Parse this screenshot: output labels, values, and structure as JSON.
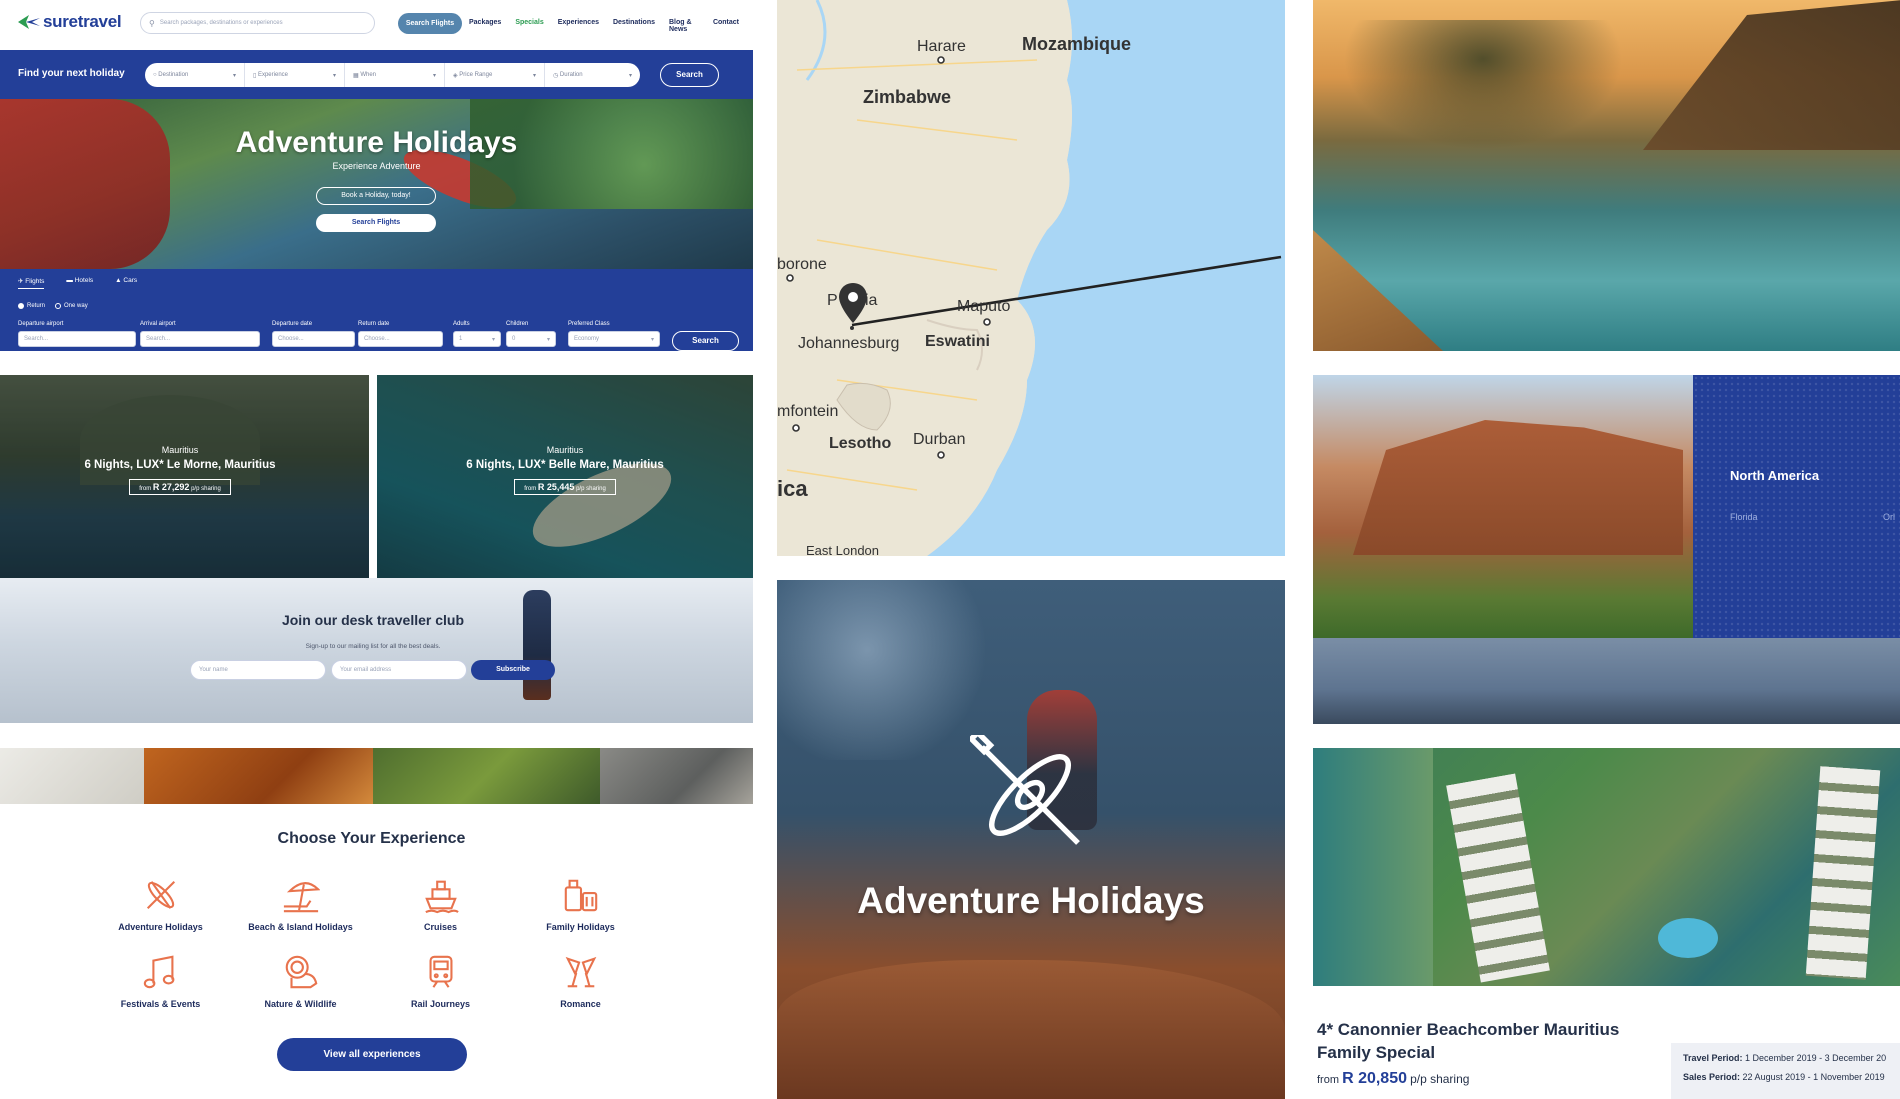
{
  "header": {
    "logo": "suretravel",
    "search_placeholder": "Search packages, destinations or experiences",
    "search_flights": "Search Flights",
    "nav": [
      "Packages",
      "Specials",
      "Experiences",
      "Destinations",
      "Blog & News",
      "Contact"
    ]
  },
  "finder": {
    "title": "Find your next holiday",
    "fields": [
      "Destination",
      "Experience",
      "When",
      "Price Range",
      "Duration"
    ],
    "search": "Search"
  },
  "hero": {
    "title": "Adventure Holidays",
    "subtitle": "Experience Adventure",
    "book_button": "Book a Holiday, today!",
    "search_flights": "Search Flights"
  },
  "flights": {
    "tabs": [
      "Flights",
      "Hotels",
      "Cars"
    ],
    "trip": [
      "Return",
      "One way"
    ],
    "labels": {
      "departure_airport": "Departure airport",
      "arrival_airport": "Arrival airport",
      "departure_date": "Departure date",
      "return_date": "Return date",
      "adults": "Adults",
      "children": "Children",
      "class": "Preferred Class"
    },
    "values": {
      "departure_placeholder": "Search...",
      "arrival_placeholder": "Search...",
      "depdate_placeholder": "Choose...",
      "retdate_placeholder": "Choose...",
      "adults": "1",
      "children": "0",
      "class": "Economy"
    },
    "search": "Search"
  },
  "deals": [
    {
      "location": "Mauritius",
      "title": "6 Nights, LUX* Le Morne, Mauritius",
      "from": "from",
      "price": "R 27,292",
      "sharing": "p/p sharing"
    },
    {
      "location": "Mauritius",
      "title": "6 Nights, LUX* Belle Mare, Mauritius",
      "from": "from",
      "price": "R 25,445",
      "sharing": "p/p sharing"
    }
  ],
  "club": {
    "title": "Join our desk traveller club",
    "subtitle": "Sign-up to our mailing list for all the best deals.",
    "name_placeholder": "Your name",
    "email_placeholder": "Your email address",
    "button": "Subscribe"
  },
  "experience": {
    "title": "Choose Your Experience",
    "items": [
      {
        "label": "Adventure Holidays",
        "icon": "kayak-icon"
      },
      {
        "label": "Beach & Island Holidays",
        "icon": "beach-umbrella-icon"
      },
      {
        "label": "Cruises",
        "icon": "ship-icon"
      },
      {
        "label": "Family Holidays",
        "icon": "luggage-icon"
      },
      {
        "label": "Festivals & Events",
        "icon": "music-note-icon"
      },
      {
        "label": "Nature & Wildlife",
        "icon": "lion-icon"
      },
      {
        "label": "Rail Journeys",
        "icon": "train-icon"
      },
      {
        "label": "Romance",
        "icon": "champagne-glasses-icon"
      }
    ],
    "view_all": "View all experiences"
  },
  "map": {
    "labels": [
      "Harare",
      "Mozambique",
      "Zimbabwe",
      "Gaborone",
      "Pretoria",
      "Maputo",
      "Johannesburg",
      "Eswatini",
      "Bloemfontein",
      "Lesotho",
      "Durban",
      "South Africa",
      "East London"
    ],
    "visible_labels": {
      "harare": "Harare",
      "mozambique": "Mozambique",
      "zimbabwe": "Zimbabwe",
      "gaborone": "borone",
      "pretoria": "P     ria",
      "maputo": "Maputo",
      "johannesburg": "Johannesburg",
      "eswatini": "Eswatini",
      "bloemfontein": "mfontein",
      "lesotho": "Lesotho",
      "durban": "Durban",
      "southafrica": "ica",
      "eastlondon": "East London"
    }
  },
  "adventure_tile": {
    "title": "Adventure Holidays"
  },
  "north_america": {
    "title": "North America",
    "florida": "Florida",
    "orl": "Orl"
  },
  "beachcomber": {
    "title": "4* Canonnier Beachcomber Mauritius Family Special",
    "from": "from",
    "price": "R 20,850",
    "sharing": "p/p sharing",
    "travel_label": "Travel Period:",
    "travel_value": "1 December 2019 - 3 December 20",
    "sales_label": "Sales Period:",
    "sales_value": "22 August 2019 - 1 November 2019"
  },
  "colors": {
    "brand_blue": "#233f98",
    "brand_green": "#2c9c52",
    "icon_orange": "#e8734d",
    "sea_blue": "#a9d6f5"
  }
}
